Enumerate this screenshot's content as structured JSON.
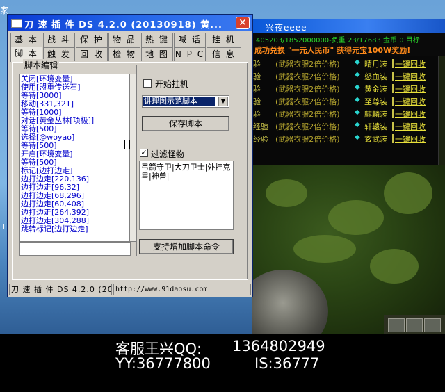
{
  "desktop": {
    "corner_label": "家",
    "side_label": "T"
  },
  "game": {
    "title": "兴夜eeee",
    "stats": "405203/1852000000-负重 23/17683 金币 0 目标",
    "promo": "成功兑换 \"一元人民币\" 获得元宝100W奖励!",
    "rows": [
      {
        "left": "验",
        "mid": "(武器衣服2倍价格)",
        "equip": "晴月装",
        "action": "一键回收"
      },
      {
        "left": "验",
        "mid": "(武器衣服2倍价格)",
        "equip": "怒血装",
        "action": "一键回收"
      },
      {
        "left": "验",
        "mid": "(武器衣服2倍价格)",
        "equip": "黄金装",
        "action": "一键回收"
      },
      {
        "left": "验",
        "mid": "(武器衣服2倍价格)",
        "equip": "至尊装",
        "action": "一键回收"
      },
      {
        "left": "验",
        "mid": "(武器衣服2倍价格)",
        "equip": "麒麟装",
        "action": "一键回收"
      },
      {
        "left": "经验",
        "mid": "(武器衣服2倍价格)",
        "equip": "轩辕装",
        "action": "一键回收"
      },
      {
        "left": "经验",
        "mid": "(武器衣服2倍价格)",
        "equip": "玄武装",
        "action": "一键回收"
      }
    ]
  },
  "window": {
    "title": "刀 速 插 件 DS 4.2.0 (20130918) 黄...",
    "close": "✕",
    "tabs_row1": [
      "基 本",
      "战 斗",
      "保 护",
      "物 品",
      "热 键",
      "喊 话",
      "挂 机"
    ],
    "tabs_row2": [
      "脚 本",
      "触 发",
      "回 收",
      "检 物",
      "地 图",
      "N P C",
      "信 息"
    ],
    "group_title": "脚本编辑",
    "script_lines": [
      "关闭[环境变量]",
      "使用[盟重传送石]",
      "等待[3000]",
      "移动[331,321]",
      "等待[1000]",
      "对话[黄金丛林[项极]]",
      "等待[500]",
      "选择[@woyao]",
      "等待[500]",
      "开启[环境变量]",
      "等待[500]",
      "标记[边打边走]",
      "边打边走[220,136]",
      "边打边走[96,32]",
      "边打边走[68,296]",
      "边打边走[60,408]",
      "边打边走[264,392]",
      "边打边走[304,288]",
      "跳转标记[边打边走]"
    ],
    "start_hang_label": "开始挂机",
    "start_hang_checked": false,
    "script_select_value": "讲理图示范脚本",
    "save_script_button": "保存脚本",
    "filter_monster_label": "过滤怪物",
    "filter_monster_checked": true,
    "filter_monster_text": "弓箭守卫|大刀卫士|外挂克星|神兽|",
    "support_button": "支持增加脚本命令",
    "status_left": "刀 速 插 件 DS 4.2.0 (201",
    "status_right": "http://www.91daosu.com"
  },
  "caption": {
    "line1_prefix": "客服王兴QQ:",
    "line1_qq": "1364802949",
    "line2_yy": "YY:36777800",
    "line2_is": "IS:36777"
  }
}
